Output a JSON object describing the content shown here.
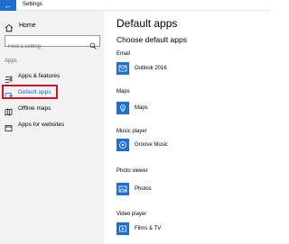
{
  "window": {
    "title": "Settings",
    "back_glyph": "←"
  },
  "sidebar": {
    "home_label": "Home",
    "search_placeholder": "Find a setting",
    "section_label": "Apps",
    "items": [
      {
        "label": "Apps & features",
        "icon": "apps-features-icon"
      },
      {
        "label": "Default apps",
        "icon": "default-apps-icon",
        "active": true
      },
      {
        "label": "Offline maps",
        "icon": "offline-maps-icon"
      },
      {
        "label": "Apps for websites",
        "icon": "apps-for-websites-icon"
      }
    ]
  },
  "main": {
    "title": "Default apps",
    "subtitle": "Choose default apps",
    "categories": [
      {
        "label": "Email",
        "app": "Outlook 2016",
        "icon": "outlook-icon"
      },
      {
        "label": "Maps",
        "app": "Maps",
        "icon": "maps-icon"
      },
      {
        "label": "Music player",
        "app": "Groove Music",
        "icon": "groove-music-icon"
      },
      {
        "label": "Photo viewer",
        "app": "Photos",
        "icon": "photos-icon"
      },
      {
        "label": "Video player",
        "app": "Films & TV",
        "icon": "films-tv-icon"
      }
    ]
  },
  "colors": {
    "accent": "#1f6fd1",
    "highlight": "#d0142a",
    "active_text": "#1a6ed8",
    "sidebar_bg": "#f2f2f2"
  }
}
